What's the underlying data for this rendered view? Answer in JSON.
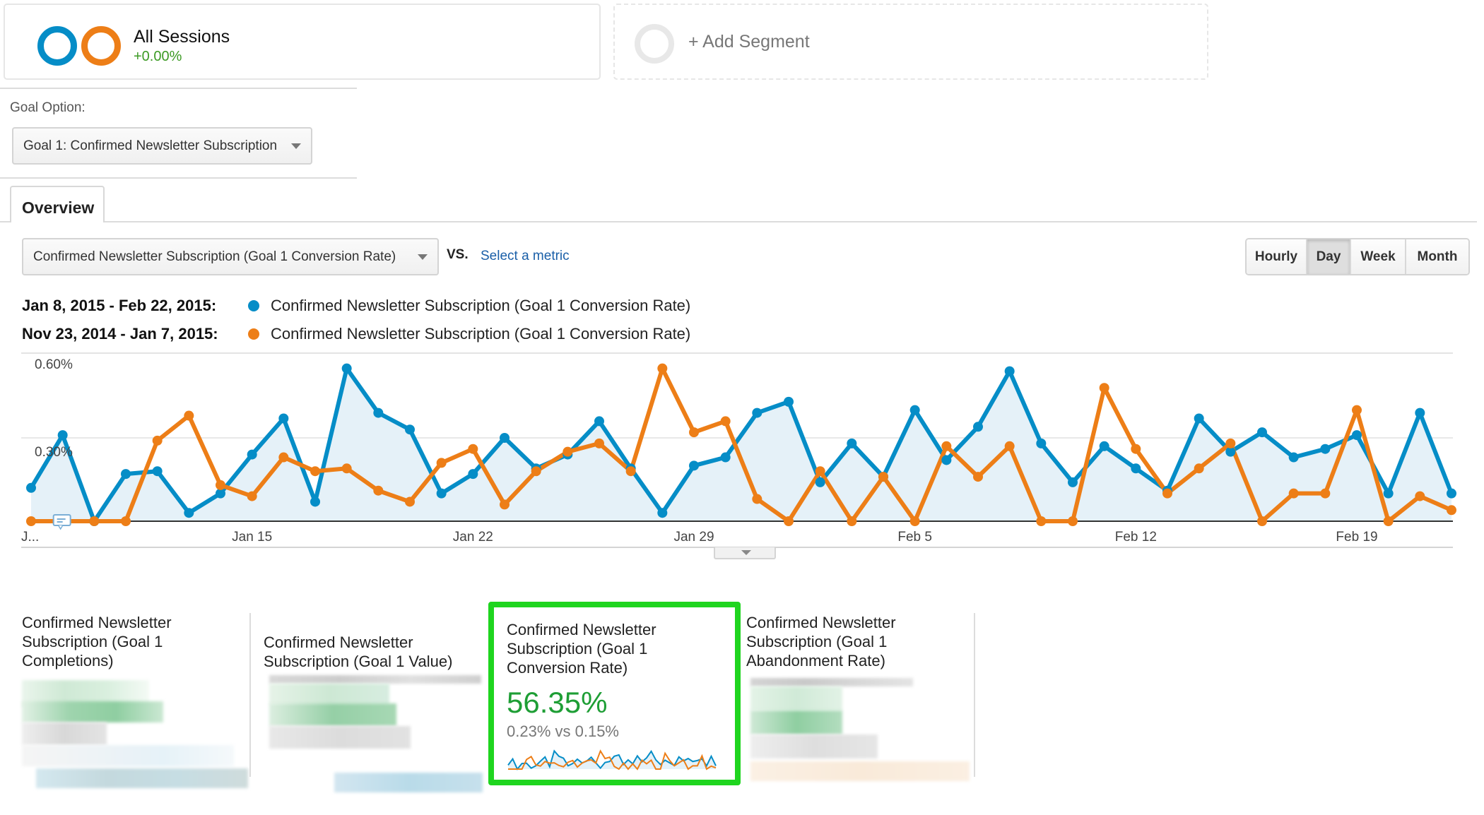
{
  "segments": {
    "active": {
      "title": "All Sessions",
      "delta": "+0.00%",
      "ring_colors": [
        "#058dc7",
        "#ed7e17"
      ]
    },
    "add_label": "+ Add Segment"
  },
  "goal_option": {
    "label": "Goal Option:",
    "selected": "Goal 1: Confirmed Newsletter Subscription"
  },
  "tabs": [
    {
      "label": "Overview",
      "active": true
    }
  ],
  "metric_selector": {
    "selected": "Confirmed Newsletter Subscription (Goal 1 Conversion Rate)",
    "vs_label": "VS.",
    "select_metric_link": "Select a metric"
  },
  "interval_buttons": [
    {
      "label": "Hourly",
      "active": false
    },
    {
      "label": "Day",
      "active": true
    },
    {
      "label": "Week",
      "active": false
    },
    {
      "label": "Month",
      "active": false
    }
  ],
  "legend": [
    {
      "range": "Jan 8, 2015 - Feb 22, 2015:",
      "metric": "Confirmed Newsletter Subscription (Goal 1 Conversion Rate)",
      "color": "#058dc7"
    },
    {
      "range": "Nov 23, 2014 - Jan 7, 2015:",
      "metric": "Confirmed Newsletter Subscription (Goal 1 Conversion Rate)",
      "color": "#ed7e17"
    }
  ],
  "chart_data": {
    "type": "line",
    "title": "",
    "xlabel": "",
    "ylabel": "",
    "ylim": [
      0,
      0.6
    ],
    "y_unit": "%",
    "y_ticks": [
      "0.30%",
      "0.60%"
    ],
    "grid": true,
    "x_tick_labels": [
      {
        "index": 0,
        "label": "J..."
      },
      {
        "index": 7,
        "label": "Jan 15"
      },
      {
        "index": 14,
        "label": "Jan 22"
      },
      {
        "index": 21,
        "label": "Jan 29"
      },
      {
        "index": 28,
        "label": "Feb 5"
      },
      {
        "index": 35,
        "label": "Feb 12"
      },
      {
        "index": 42,
        "label": "Feb 19"
      }
    ],
    "x_start": "Jan 8, 2015",
    "x_end": "Feb 22, 2015",
    "point_count": 46,
    "series": [
      {
        "name": "Jan 8, 2015 - Feb 22, 2015",
        "color": "#058dc7",
        "area": true,
        "values": [
          0.12,
          0.31,
          0.0,
          0.17,
          0.18,
          0.03,
          0.1,
          0.24,
          0.37,
          0.07,
          0.55,
          0.39,
          0.33,
          0.1,
          0.17,
          0.3,
          0.19,
          0.24,
          0.36,
          0.19,
          0.03,
          0.2,
          0.23,
          0.39,
          0.43,
          0.14,
          0.28,
          0.16,
          0.4,
          0.22,
          0.34,
          0.54,
          0.28,
          0.14,
          0.27,
          0.19,
          0.11,
          0.37,
          0.25,
          0.32,
          0.23,
          0.26,
          0.31,
          0.1,
          0.39,
          0.1
        ]
      },
      {
        "name": "Nov 23, 2014 - Jan 7, 2015",
        "color": "#ed7e17",
        "area": false,
        "values": [
          0.0,
          0.0,
          0.0,
          0.0,
          0.29,
          0.38,
          0.13,
          0.09,
          0.23,
          0.18,
          0.19,
          0.11,
          0.07,
          0.21,
          0.26,
          0.06,
          0.18,
          0.25,
          0.28,
          0.18,
          0.55,
          0.32,
          0.36,
          0.08,
          0.0,
          0.18,
          0.0,
          0.16,
          0.0,
          0.27,
          0.16,
          0.27,
          0.0,
          0.0,
          0.48,
          0.26,
          0.1,
          0.19,
          0.28,
          0.0,
          0.1,
          0.1,
          0.4,
          0.0,
          0.09,
          0.04
        ]
      }
    ],
    "annotation_marker": {
      "index": 1,
      "icon": "annotation-icon"
    }
  },
  "scorecards": [
    {
      "title_lines": [
        "Confirmed Newsletter",
        "Subscription (Goal 1",
        "Completions)"
      ],
      "value_obscured": true,
      "selected": false
    },
    {
      "title_lines": [
        "Confirmed Newsletter",
        "Subscription (Goal 1 Value)"
      ],
      "value_obscured": true,
      "selected": false
    },
    {
      "title_lines": [
        "Confirmed Newsletter",
        "Subscription (Goal 1",
        "Conversion Rate)"
      ],
      "value": "56.35%",
      "comparison": "0.23% vs 0.15%",
      "selected": true,
      "highlight_color": "#1fd51f"
    },
    {
      "title_lines": [
        "Confirmed Newsletter",
        "Subscription (Goal 1",
        "Abandonment Rate)"
      ],
      "value_obscured": true,
      "selected": false
    }
  ]
}
